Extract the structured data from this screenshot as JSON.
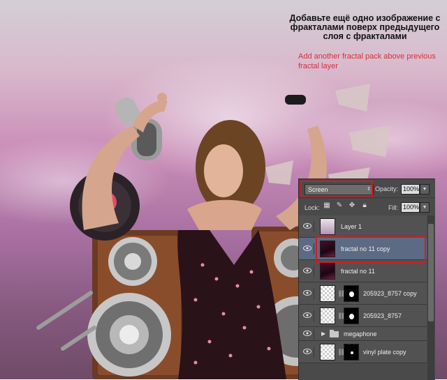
{
  "annotation": {
    "russian": "Добавьте ещё одно изображение с фракталами поверх предыдущего слоя с фракталами",
    "english": "Add another fractal pack above previous fractal layer"
  },
  "layers_panel": {
    "blend_mode": "Screen",
    "opacity_label": "Opacity:",
    "opacity_value": "100%",
    "lock_label": "Lock:",
    "fill_label": "Fill:",
    "fill_value": "100%",
    "layers": [
      {
        "name": "Layer 1",
        "selected": false
      },
      {
        "name": "fractal no 11 copy",
        "selected": true
      },
      {
        "name": "fractal no 11",
        "selected": false
      },
      {
        "name": "205923_8757 copy",
        "selected": false
      },
      {
        "name": "205923_8757",
        "selected": false
      },
      {
        "name": "megaphone",
        "group": true
      },
      {
        "name": "vinyl plate copy",
        "selected": false
      }
    ]
  },
  "colors": {
    "highlight": "#d01c23",
    "annotation_red": "#d4303b",
    "panel_bg": "#4a4a4a",
    "selected_layer": "#5d6a84"
  }
}
